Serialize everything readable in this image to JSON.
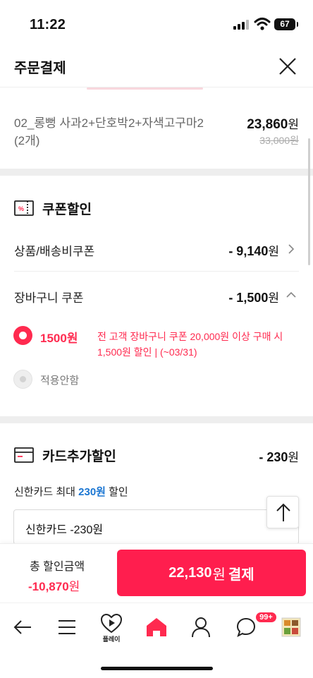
{
  "status_bar": {
    "time": "11:22",
    "battery": "67"
  },
  "header": {
    "title": "주문결제"
  },
  "product": {
    "name": "02_롱뻥 사과2+단호박2+자색고구마2 (2개)",
    "price": "23,860",
    "price_unit": "원",
    "original_price": "33,000원"
  },
  "coupon": {
    "title": "쿠폰할인",
    "icon_text": "%",
    "rows": [
      {
        "label": "상품/배송비쿠폰",
        "value": "- 9,140",
        "unit": "원"
      },
      {
        "label": "장바구니 쿠폰",
        "value": "- 1,500",
        "unit": "원"
      }
    ],
    "options": [
      {
        "amount": "1500원",
        "desc": "전 고객 장바구니 쿠폰 20,000원 이상 구매 시 1,500원 할인 | (~03/31)",
        "selected": true
      },
      {
        "amount": "",
        "desc": "적용안함",
        "selected": false
      }
    ]
  },
  "card": {
    "title": "카드추가할인",
    "total": "- 230",
    "unit": "원",
    "promo_prefix": "신한카드 최대 ",
    "promo_amount": "230원",
    "promo_suffix": " 할인",
    "selected_option": "신한카드 -230원"
  },
  "footer": {
    "total_label": "총 할인금액",
    "total_value": "-10,870",
    "total_unit": "원",
    "pay_amount": "22,130",
    "pay_unit": "원",
    "pay_action": "결제"
  },
  "bottom_nav": {
    "play_label": "플레이",
    "chat_badge": "99+"
  },
  "colors": {
    "accent": "#ff1e4e",
    "link": "#1b76d2"
  }
}
